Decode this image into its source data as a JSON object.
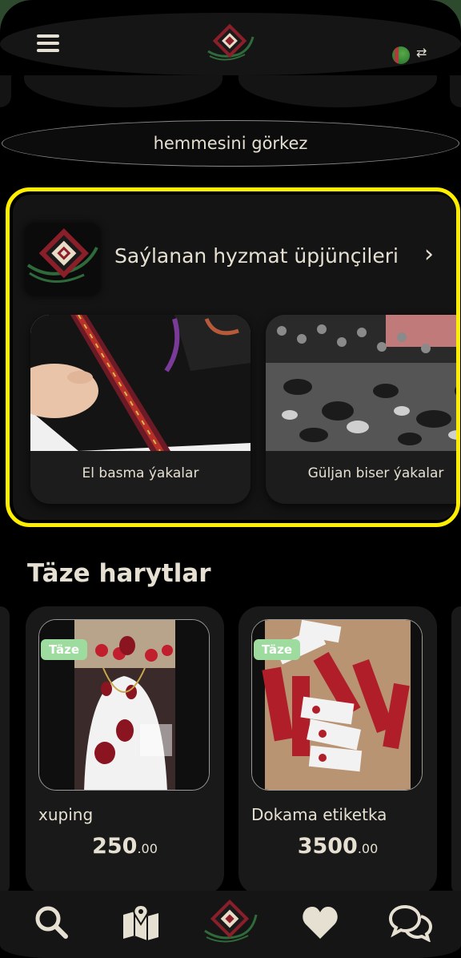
{
  "header": {
    "menu_icon": "hamburger-icon",
    "logo": "turkmen-pattern-logo",
    "language_flag": "turkmenistan-flag-icon",
    "swap_icon": "swap-arrows-icon"
  },
  "show_all": {
    "label": "hemmesini görkez"
  },
  "providers": {
    "title": "Saýlanan hyzmat üpjünçileri",
    "chevron_icon": "chevron-right-icon",
    "items": [
      {
        "label": "El basma ýakalar"
      },
      {
        "label": "Güljan biser ýakalar"
      }
    ]
  },
  "new_products": {
    "title": "Täze harytlar",
    "items": [
      {
        "badge": "Täze",
        "name": "xuping",
        "price": "250",
        "decimals": ".00"
      },
      {
        "badge": "Täze",
        "name": "Dokama etiketka",
        "price": "3500",
        "decimals": ".00"
      }
    ]
  },
  "bottom_nav": [
    {
      "icon": "search-icon"
    },
    {
      "icon": "map-icon"
    },
    {
      "icon": "home-logo-icon"
    },
    {
      "icon": "heart-icon"
    },
    {
      "icon": "chat-icon"
    }
  ],
  "colors": {
    "accent_highlight": "#ffee00",
    "badge_green": "#9edb9e",
    "text": "#e6e0d2",
    "page_border": "#2e4a2e"
  }
}
